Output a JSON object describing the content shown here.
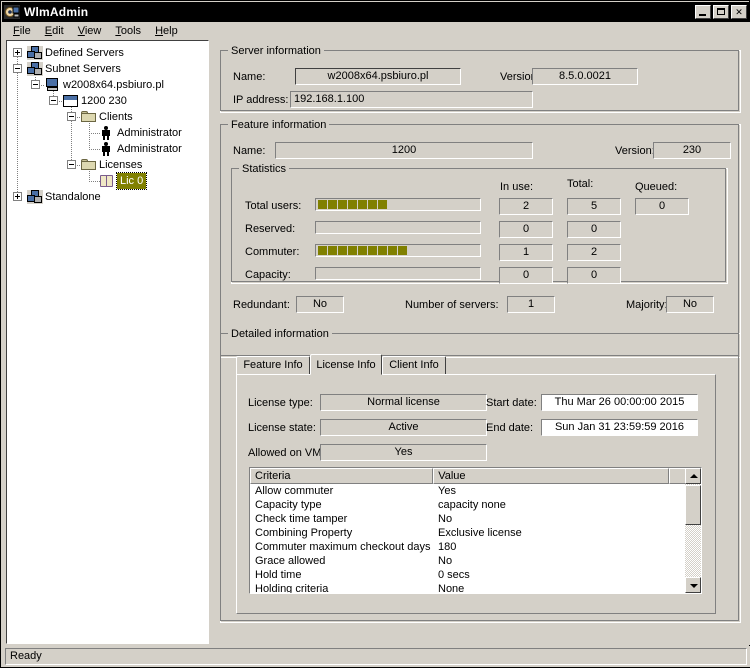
{
  "window": {
    "title": "WlmAdmin",
    "icon": "app-icon",
    "buttons": {
      "minimize": "minimize",
      "maximize": "maximize",
      "close": "✕"
    }
  },
  "menu": [
    {
      "label": "File",
      "accel": "F"
    },
    {
      "label": "Edit",
      "accel": "E"
    },
    {
      "label": "View",
      "accel": "V"
    },
    {
      "label": "Tools",
      "accel": "T"
    },
    {
      "label": "Help",
      "accel": "H"
    }
  ],
  "tree": [
    {
      "label": "Defined Servers",
      "indent": 0,
      "expander": "plus",
      "icon": "servers-icon",
      "selected": false
    },
    {
      "label": "Subnet Servers",
      "indent": 0,
      "expander": "minus",
      "icon": "servers-icon",
      "selected": false
    },
    {
      "label": "w2008x64.psbiuro.pl",
      "indent": 1,
      "expander": "minus",
      "icon": "computer-icon",
      "selected": false
    },
    {
      "label": "1200 230",
      "indent": 2,
      "expander": "minus",
      "icon": "window-icon",
      "selected": false
    },
    {
      "label": "Clients",
      "indent": 3,
      "expander": "minus",
      "icon": "folder-icon",
      "selected": false
    },
    {
      "label": "Administrator",
      "indent": 4,
      "expander": "none",
      "icon": "person-icon",
      "selected": false
    },
    {
      "label": "Administrator",
      "indent": 4,
      "expander": "none",
      "icon": "person-icon",
      "selected": false
    },
    {
      "label": "Licenses",
      "indent": 3,
      "expander": "minus",
      "icon": "folder-icon",
      "selected": false
    },
    {
      "label": "Lic 0",
      "indent": 4,
      "expander": "none",
      "icon": "license-icon",
      "selected": true
    },
    {
      "label": "Standalone",
      "indent": 0,
      "expander": "plus",
      "icon": "servers-icon",
      "selected": false
    }
  ],
  "server_information": {
    "group_title": "Server information",
    "name_label": "Name:",
    "name_value": "w2008x64.psbiuro.pl",
    "version_label": "Version:",
    "version_value": "8.5.0.0021",
    "ip_label": "IP address:",
    "ip_value": "192.168.1.100"
  },
  "feature_information": {
    "group_title": "Feature information",
    "name_label": "Name:",
    "name_value": "1200",
    "version_label": "Version:",
    "version_value": "230",
    "statistics": {
      "group_title": "Statistics",
      "col_inuse": "In use:",
      "col_total": "Total:",
      "col_queued": "Queued:",
      "rows": [
        {
          "label": "Total users:",
          "segments": 7,
          "in_use": "2",
          "total": "5",
          "queued": "0"
        },
        {
          "label": "Reserved:",
          "segments": 0,
          "in_use": "0",
          "total": "0",
          "queued": ""
        },
        {
          "label": "Commuter:",
          "segments": 9,
          "in_use": "1",
          "total": "2",
          "queued": ""
        },
        {
          "label": "Capacity:",
          "segments": 0,
          "in_use": "0",
          "total": "0",
          "queued": ""
        }
      ]
    },
    "redundant_label": "Redundant:",
    "redundant_value": "No",
    "num_servers_label": "Number of servers:",
    "num_servers_value": "1",
    "majority_label": "Majority:",
    "majority_value": "No"
  },
  "detailed_information": {
    "group_title": "Detailed information",
    "tabs": [
      {
        "label": "Feature Info",
        "active": false
      },
      {
        "label": "License Info",
        "active": true
      },
      {
        "label": "Client Info",
        "active": false
      }
    ],
    "license_info": {
      "license_type_label": "License type:",
      "license_type_value": "Normal license",
      "license_state_label": "License state:",
      "license_state_value": "Active",
      "allowed_vm_label": "Allowed on VM:",
      "allowed_vm_value": "Yes",
      "start_date_label": "Start date:",
      "start_date_value": "Thu Mar 26 00:00:00 2015",
      "end_date_label": "End date:",
      "end_date_value": "Sun Jan 31 23:59:59 2016"
    },
    "criteria_table": {
      "columns": [
        "Criteria",
        "Value",
        ""
      ],
      "rows": [
        [
          "Allow commuter",
          "Yes"
        ],
        [
          "Capacity type",
          "capacity none"
        ],
        [
          "Check time tamper",
          "No"
        ],
        [
          "Combining Property",
          "Exclusive license"
        ],
        [
          "Commuter maximum checkout days",
          "180"
        ],
        [
          "Grace allowed",
          "No"
        ],
        [
          "Hold time",
          "0 secs"
        ],
        [
          "Holding criteria",
          "None"
        ]
      ]
    }
  },
  "statusbar": {
    "text": "Ready"
  },
  "colors": {
    "face": "#d4d0c8",
    "bar_fill": "#808000",
    "selection": "#808000",
    "titlebar": "#000000"
  }
}
